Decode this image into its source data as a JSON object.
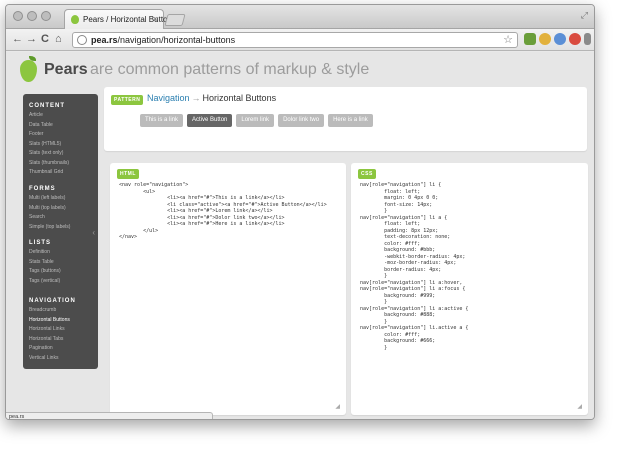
{
  "browser": {
    "tab_title": "Pears / Horizontal Buttons",
    "tab_close": "×",
    "resize_glyph": "⤢",
    "url_host": "pea.rs",
    "url_path": "/navigation/horizontal-buttons",
    "back": "←",
    "forward": "→",
    "reload": "C",
    "home": "⌂",
    "star": "☆",
    "status": "pea.rs"
  },
  "site": {
    "name": "Pears",
    "tagline": "are common patterns of markup & style",
    "accent": "#8cc63f",
    "link_color": "#2a7fb0"
  },
  "sidebar": {
    "collapse_glyph": "‹",
    "sections": [
      {
        "title": "CONTENT",
        "items": [
          "Article",
          "Data Table",
          "Footer",
          "Slats (HTML5)",
          "Slats (text only)",
          "Slats (thumbnails)",
          "Thumbnail Grid"
        ]
      },
      {
        "title": "FORMS",
        "items": [
          "Multi (left labels)",
          "Multi (top labels)",
          "Search",
          "Simple (top labels)"
        ]
      },
      {
        "title": "LISTS",
        "items": [
          "Definition",
          "Stats Table",
          "Tags (buttons)",
          "Tags (vertical)"
        ]
      },
      {
        "title": "NAVIGATION",
        "items": [
          "Breadcrumb",
          "Horizontal Buttons",
          "Horizontal Links",
          "Horizontal Tabs",
          "Pagination",
          "Vertical Links"
        ]
      }
    ]
  },
  "pattern": {
    "badge": "PATTERN",
    "category": "Navigation",
    "arrow": "→",
    "name": "Horizontal Buttons",
    "buttons": [
      {
        "label": "This is a link",
        "active": false
      },
      {
        "label": "Active Button",
        "active": true
      },
      {
        "label": "Lorem link",
        "active": false
      },
      {
        "label": "Dolor link two",
        "active": false
      },
      {
        "label": "Here is a link",
        "active": false
      }
    ]
  },
  "html_panel": {
    "badge": "HTML",
    "code": "<nav role=\"navigation\">\n        <ul>\n                <li><a href=\"#\">This is a link</a></li>\n                <li class=\"active\"><a href=\"#\">Active Button</a></li>\n                <li><a href=\"#\">Lorem link</a></li>\n                <li><a href=\"#\">Dolor link two</a></li>\n                <li><a href=\"#\">Here is a link</a></li>\n        </ul>\n</nav>"
  },
  "css_panel": {
    "badge": "CSS",
    "code": "nav[role=\"navigation\"] li {\n        float: left;\n        margin: 0 4px 0 0;\n        font-size: 14px;\n        }\nnav[role=\"navigation\"] li a {\n        float: left;\n        padding: 8px 12px;\n        text-decoration: none;\n        color: #fff;\n        background: #bbb;\n        -webkit-border-radius: 4px;\n        -moz-border-radius: 4px;\n        border-radius: 4px;\n        }\nnav[role=\"navigation\"] li a:hover,\nnav[role=\"navigation\"] li a:focus {\n        background: #999;\n        }\nnav[role=\"navigation\"] li a:active {\n        background: #888;\n        }\nnav[role=\"navigation\"] li.active a {\n        color: #fff;\n        background: #666;\n        }"
  }
}
